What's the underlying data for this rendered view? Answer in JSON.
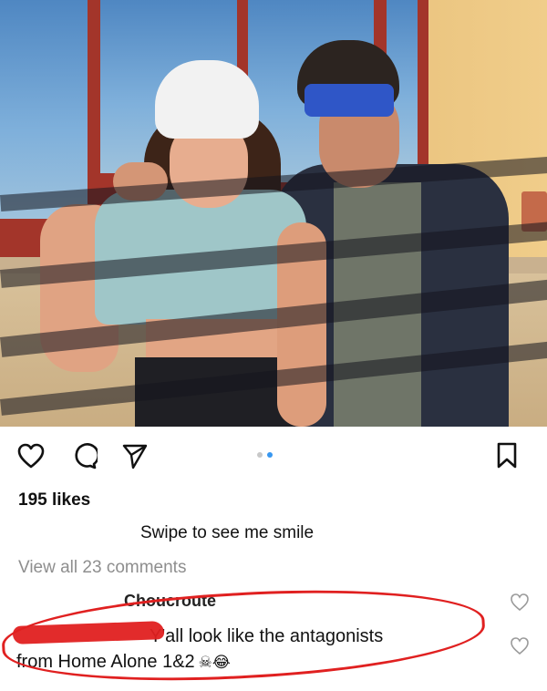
{
  "post": {
    "image_alt": "",
    "likes_text": "195 likes",
    "caption": "Swipe to see me smile",
    "view_all": "View all 23 comments",
    "carousel": {
      "count": 2,
      "active_index": 1
    }
  },
  "icons": {
    "like": "heart-icon",
    "comment": "comment-bubble-icon",
    "share": "paper-plane-icon",
    "save": "bookmark-icon",
    "comment_like": "small-heart-icon"
  },
  "comments": [
    {
      "username": "Choucroute",
      "text": ""
    },
    {
      "username": "",
      "text_line1": "Y'all look like the antagonists",
      "text_line2": "from Home Alone 1&2",
      "emoji": "☠😂"
    }
  ],
  "colors": {
    "annotation_red": "#e02020",
    "accent_blue": "#3897f0",
    "muted_gray": "#8e8e8e"
  }
}
